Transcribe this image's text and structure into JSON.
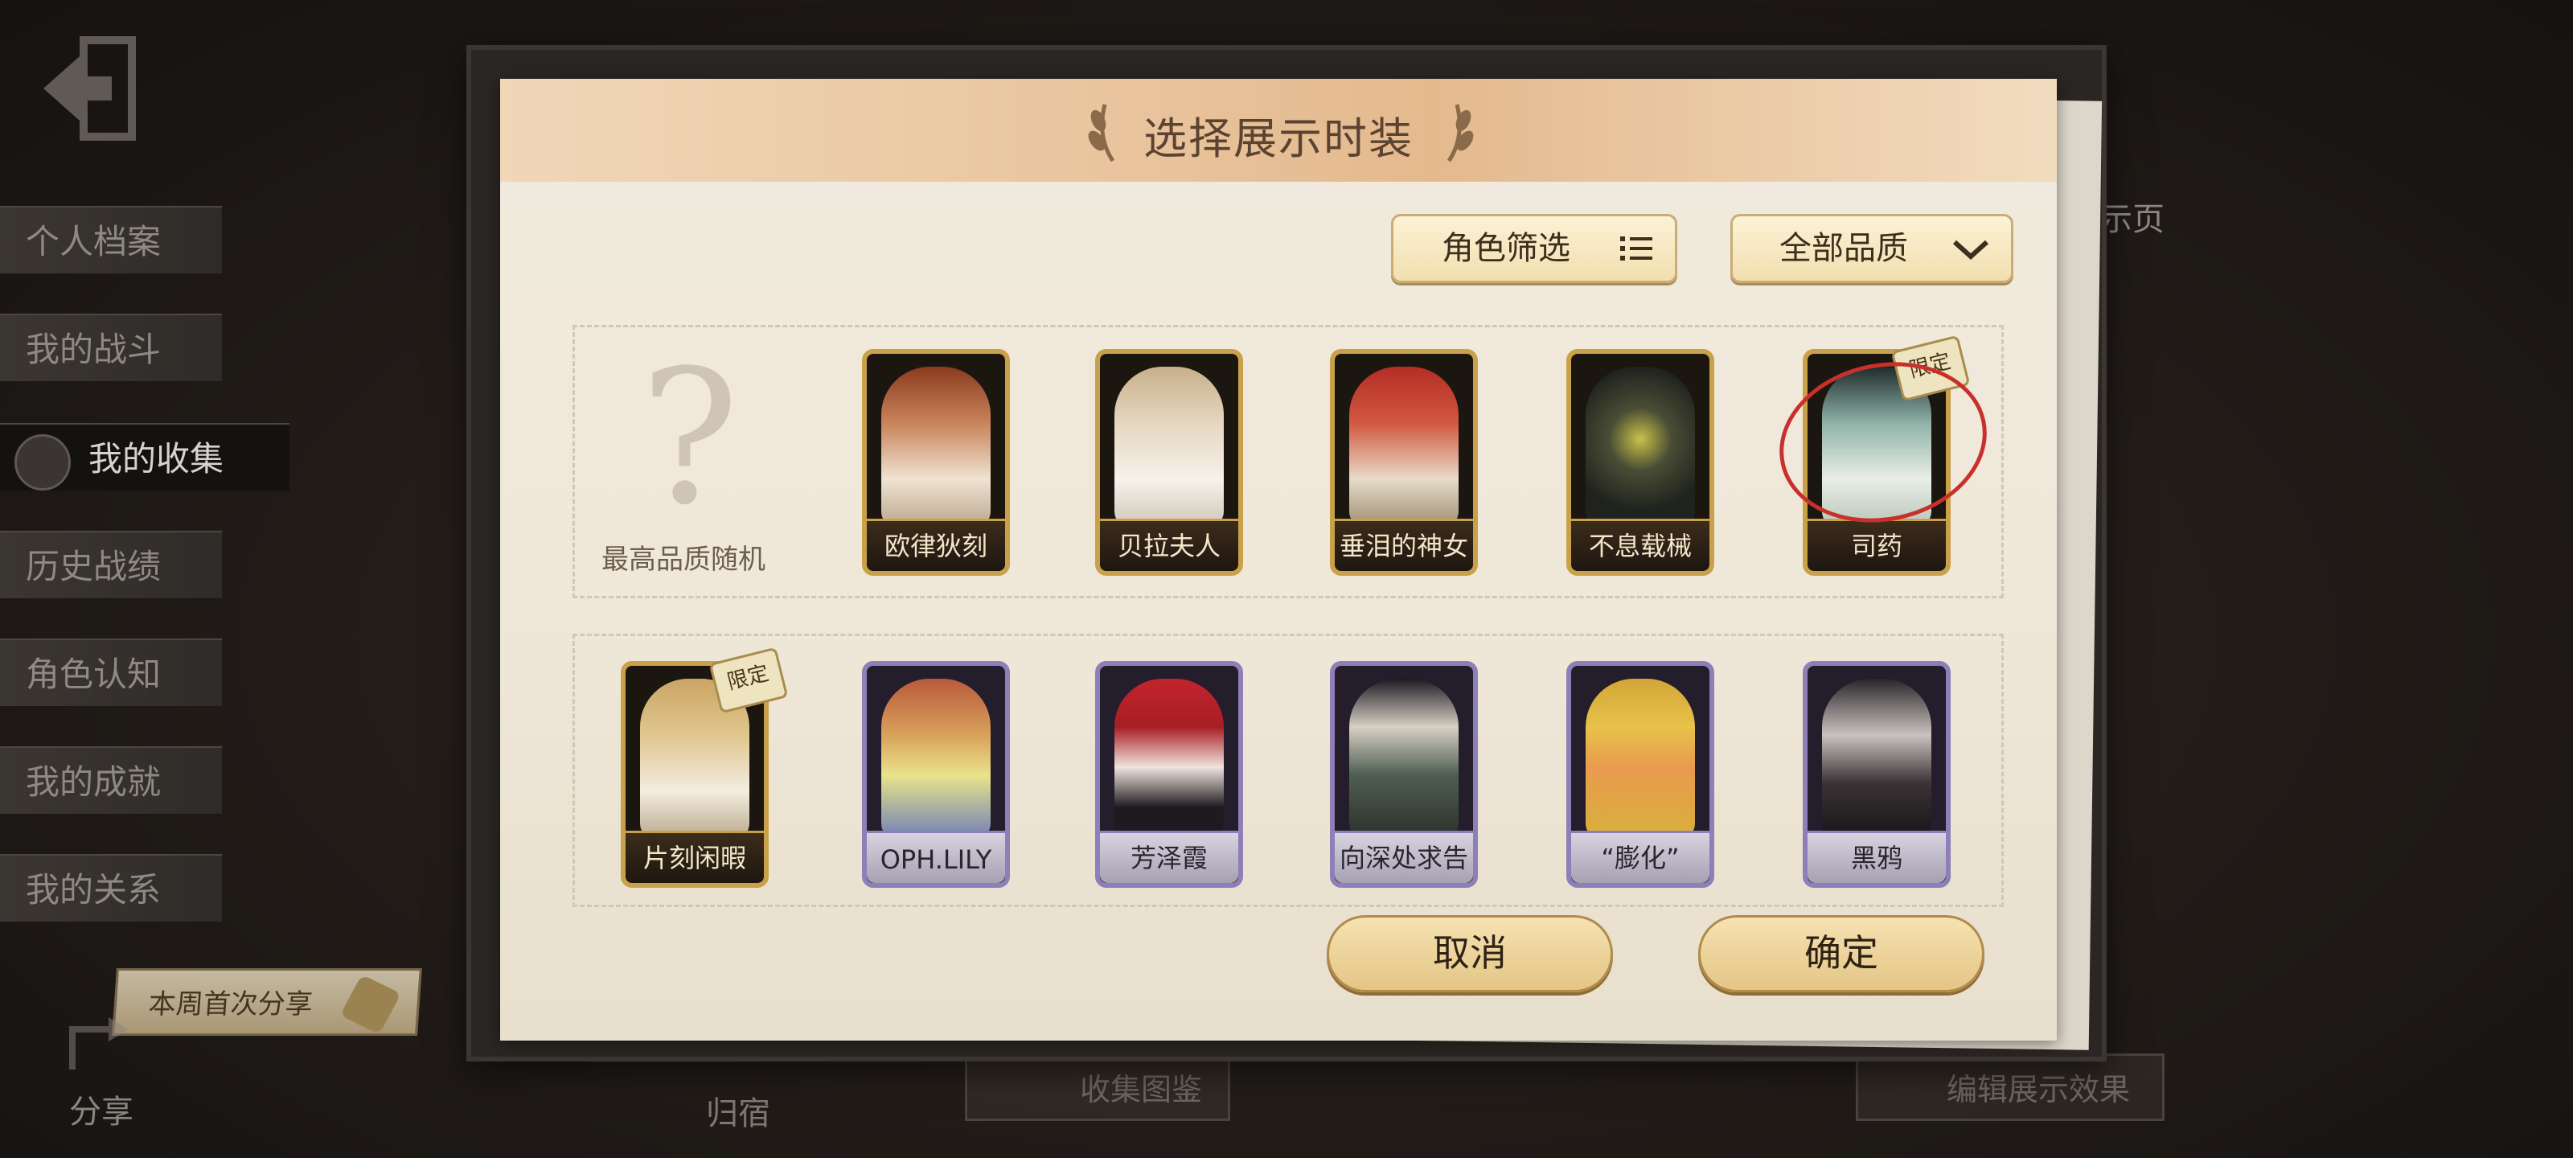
{
  "sidebar": {
    "items": [
      {
        "label": "个人档案"
      },
      {
        "label": "我的战斗"
      },
      {
        "label": "我的收集",
        "active": true
      },
      {
        "label": "历史战绩"
      },
      {
        "label": "角色认知"
      },
      {
        "label": "我的成就"
      },
      {
        "label": "我的关系"
      }
    ],
    "share_pill": "本周首次分享",
    "share_label": "分享"
  },
  "background": {
    "bottom_left_label": "归宿",
    "bottom_mid_button": "收集图鉴",
    "bottom_right_button": "编辑展示效果",
    "right_partial_label": "示页"
  },
  "dialog": {
    "title": "选择展示时装",
    "filter_role": "角色筛选",
    "filter_quality": "全部品质",
    "random_option": "最高品质随机",
    "cancel": "取消",
    "confirm": "确定"
  },
  "costumes_row1": [
    {
      "name": "欧律狄刻",
      "tier": "gold"
    },
    {
      "name": "贝拉夫人",
      "tier": "gold"
    },
    {
      "name": "垂泪的神女",
      "tier": "gold"
    },
    {
      "name": "不息载械",
      "tier": "gold"
    },
    {
      "name": "司药",
      "tier": "gold",
      "tag": "限定",
      "selected": true
    }
  ],
  "costumes_row2": [
    {
      "name": "片刻闲暇",
      "tier": "gold",
      "tag": "限定"
    },
    {
      "name": "OPH.LILY",
      "tier": "purple"
    },
    {
      "name": "芳泽霞",
      "tier": "purple"
    },
    {
      "name": "向深处求告",
      "tier": "purple"
    },
    {
      "name": "“膨化”",
      "tier": "purple"
    },
    {
      "name": "黑鸦",
      "tier": "purple"
    }
  ],
  "colors": {
    "gold_frame": "#c9a14a",
    "purple_frame": "#8e7fb8",
    "selection_circle": "#c8302c"
  }
}
